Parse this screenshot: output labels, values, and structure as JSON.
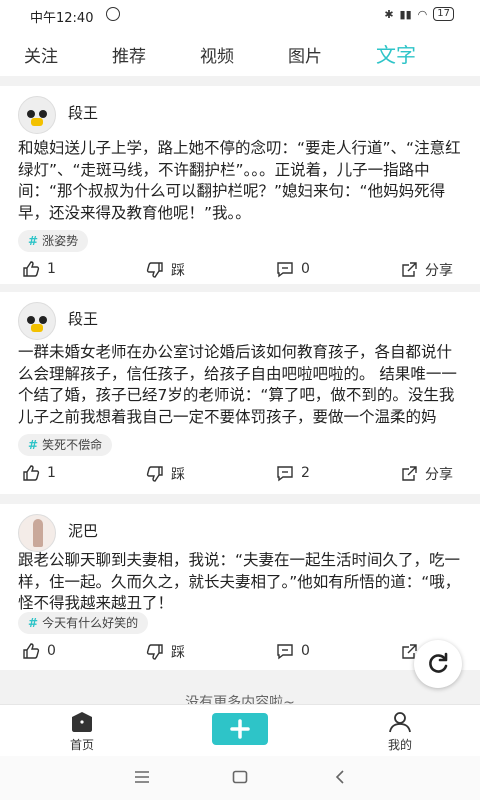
{
  "status_bar": {
    "time": "中午12:40",
    "battery": "17"
  },
  "tabs": [
    "关注",
    "推荐",
    "视频",
    "图片",
    "文字"
  ],
  "active_tab": "文字",
  "posts": [
    {
      "author": "段王",
      "text": "和媳妇送儿子上学，路上她不停的念叨：“要走人行道”、“注意红绿灯”、“走斑马线，不许翻护栏”。。。正说着，儿子一指路中间：“那个叔叔为什么可以翻护栏呢？”媳妇来句：“他妈妈死得早，还没来得及教育他呢！”我。。",
      "tag": "涨姿势",
      "likes": "1",
      "dislike_label": "踩",
      "comments": "0",
      "share_label": "分享"
    },
    {
      "author": "段王",
      "text": "一群未婚女老师在办公室讨论婚后该如何教育孩子，各自都说什么会理解孩子，信任孩子，给孩子自由吧啦吧啦的。 结果唯一一个结了婚，孩子已经7岁的老师说：“算了吧，做不到的。没生我儿子之前我想着我自己一定不要体罚孩子，要做一个温柔的妈妈，但现在我",
      "tag": "笑死不偿命",
      "likes": "1",
      "dislike_label": "踩",
      "comments": "2",
      "share_label": "分享"
    },
    {
      "author": "泥巴",
      "text": "跟老公聊天聊到夫妻相，我说：“夫妻在一起生活时间久了，吃一样，住一起。久而久之，就长夫妻相了。”他如有所悟的道：“哦，怪不得我越来越丑了！",
      "tag": "今天有什么好笑的",
      "likes": "0",
      "dislike_label": "踩",
      "comments": "0",
      "share_label": "分享"
    }
  ],
  "footer_text": "没有更多内容啦~",
  "bottom_nav": {
    "home": "首页",
    "mine": "我的"
  },
  "colors": {
    "accent": "#2ec4c8"
  }
}
